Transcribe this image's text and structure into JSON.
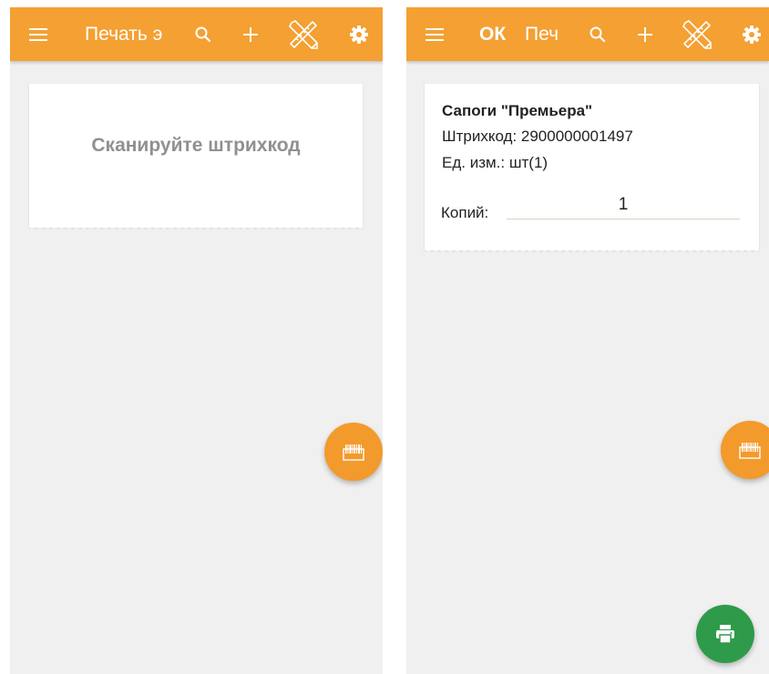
{
  "left_screen": {
    "appbar": {
      "title": "Печать э",
      "icons": [
        "menu-icon",
        "search-icon",
        "add-icon",
        "ruler-pencil-icon",
        "settings-icon"
      ]
    },
    "scan_prompt": "Сканируйте штрихкод",
    "fab": {
      "icon": "barcode-icon",
      "color": "#f39a2c"
    }
  },
  "right_screen": {
    "appbar": {
      "ok_label": "ок",
      "title": "Печ",
      "icons": [
        "menu-icon",
        "search-icon",
        "add-icon",
        "ruler-pencil-icon",
        "settings-icon"
      ]
    },
    "item": {
      "name": "Сапоги \"Премьера\"",
      "barcode": "Штрихкод: 2900000001497",
      "unit": "Ед. изм.: шт(1)",
      "copies_label": "Копий:",
      "copies_value": "1"
    },
    "fab_scan": {
      "icon": "barcode-icon",
      "color": "#f39a2c"
    },
    "fab_print": {
      "icon": "printer-icon",
      "color": "#2e9b4a"
    }
  },
  "colors": {
    "appbar": "#f4a033",
    "background": "#f0f0f0",
    "card": "#ffffff",
    "scan_text": "#909090"
  }
}
